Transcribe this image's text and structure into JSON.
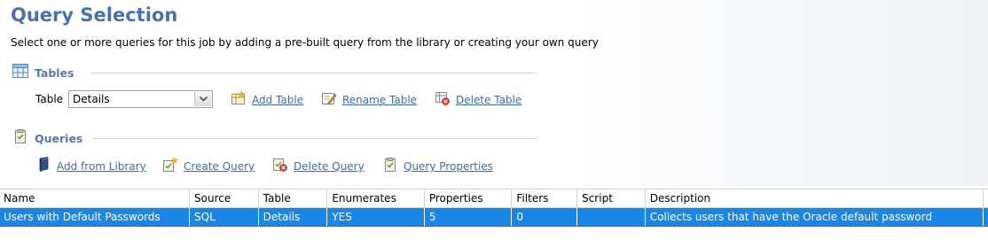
{
  "header": {
    "title": "Query Selection",
    "subtitle": "Select one or more queries for this job by adding a pre-built query from the library or creating your own query"
  },
  "tables_section": {
    "title": "Tables",
    "icon": "table-grid-icon",
    "table_label": "Table",
    "table_value": "Details",
    "actions": [
      {
        "label": "Add Table",
        "icon": "add-table-icon"
      },
      {
        "label": "Rename Table",
        "icon": "rename-table-icon"
      },
      {
        "label": "Delete Table",
        "icon": "delete-table-icon"
      }
    ]
  },
  "queries_section": {
    "title": "Queries",
    "icon": "clipboard-icon",
    "actions": [
      {
        "label": "Add from Library",
        "icon": "book-icon"
      },
      {
        "label": "Create Query",
        "icon": "create-query-icon"
      },
      {
        "label": "Delete Query",
        "icon": "delete-query-icon"
      },
      {
        "label": "Query Properties",
        "icon": "query-properties-icon"
      }
    ]
  },
  "grid": {
    "columns": [
      "Name",
      "Source",
      "Table",
      "Enumerates",
      "Properties",
      "Filters",
      "Script",
      "Description"
    ],
    "rows": [
      {
        "name": "Users with Default Passwords",
        "source": "SQL",
        "table": "Details",
        "enumerates": "YES",
        "properties": "5",
        "filters": "0",
        "script": "",
        "description": "Collects users that have the Oracle default password",
        "selected": true
      }
    ]
  },
  "colors": {
    "title": "#4b72a8",
    "section_title": "#5578a9",
    "link": "#3d6ab0",
    "selection": "#1a86e6"
  }
}
